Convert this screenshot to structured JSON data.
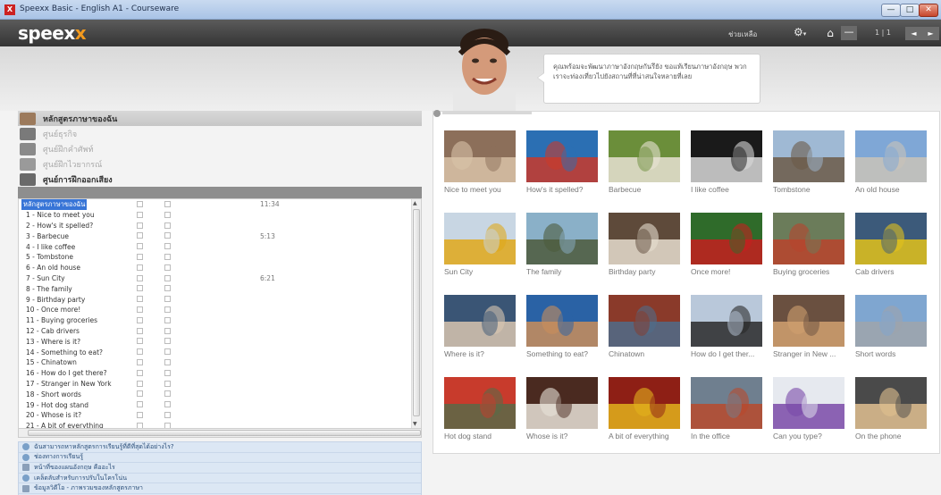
{
  "window": {
    "title": "Speexx Basic - English A1 - Courseware",
    "app_icon": "X"
  },
  "appbar": {
    "logo_main": "speex",
    "logo_accent": "x",
    "help": "ช่วยเหลือ",
    "home_icon": "⌂",
    "minus_label": "—",
    "counter": "1 | 1",
    "prev": "◄",
    "next": "►"
  },
  "tutor": {
    "message": "คุณพร้อมจะพัฒนาภาษาอังกฤษกันรึยัง ขอแท้เรียนภาษาอังกฤษ พวกเราจะท่องเที่ยวไปยังสถานที่ที่น่าสนใจหลายที่เลย"
  },
  "sections": [
    {
      "label": "หลักสูตรภาษาของฉัน",
      "state": "active"
    },
    {
      "label": "ศูนย์ธุรกิจ",
      "state": "disabled"
    },
    {
      "label": "ศูนย์ฝึกคำศัพท์",
      "state": "disabled"
    },
    {
      "label": "ศูนย์ฝึกไวยากรณ์",
      "state": "disabled"
    },
    {
      "label": "ศูนย์การฝึกออกเสียง",
      "state": "bold"
    }
  ],
  "tree": {
    "root": "หลักสูตรภาษาของฉัน",
    "root_time": "11:34",
    "items": [
      {
        "label": "1 - Nice to meet you",
        "time": ""
      },
      {
        "label": "2 - How's it spelled?",
        "time": ""
      },
      {
        "label": "3 - Barbecue",
        "time": "5:13"
      },
      {
        "label": "4 - I like coffee",
        "time": ""
      },
      {
        "label": "5 - Tombstone",
        "time": ""
      },
      {
        "label": "6 - An old house",
        "time": ""
      },
      {
        "label": "7 - Sun City",
        "time": "6:21"
      },
      {
        "label": "8 - The family",
        "time": ""
      },
      {
        "label": "9 - Birthday party",
        "time": ""
      },
      {
        "label": "10 - Once more!",
        "time": ""
      },
      {
        "label": "11 - Buying groceries",
        "time": ""
      },
      {
        "label": "12 - Cab drivers",
        "time": ""
      },
      {
        "label": "13 - Where is it?",
        "time": ""
      },
      {
        "label": "14 - Something to eat?",
        "time": ""
      },
      {
        "label": "15 - Chinatown",
        "time": ""
      },
      {
        "label": "16 - How do I get there?",
        "time": ""
      },
      {
        "label": "17 - Stranger in New York",
        "time": ""
      },
      {
        "label": "18 - Short words",
        "time": ""
      },
      {
        "label": "19 - Hot dog stand",
        "time": ""
      },
      {
        "label": "20 - Whose is it?",
        "time": ""
      },
      {
        "label": "21 - A bit of everything",
        "time": ""
      }
    ],
    "hscroll_mark": "III"
  },
  "help_items": [
    {
      "label": "ฉันสามารถหาหลักสูตรการเรียนรู้ที่ดีที่สุดได้อย่างไร?",
      "icon": "help-circle"
    },
    {
      "label": "ช่องทางการเรียนรู้",
      "icon": "help-circle"
    },
    {
      "label": "หน้าที่ของแผนอังกฤษ คืออะไร",
      "icon": "doc"
    },
    {
      "label": "เคล็ดลับสำหรับการปรับในโครโน่น",
      "icon": "help-circle"
    },
    {
      "label": "ข้อมูลวิดีโอ - ภาพรวมของหลักสูตรภาษา",
      "icon": "doc"
    }
  ],
  "units": [
    {
      "caption": "Nice to meet you",
      "c1": "#8c6f5a",
      "c2": "#d9c3a8"
    },
    {
      "caption": "How's it spelled?",
      "c1": "#2b6fb3",
      "c2": "#c93a2a"
    },
    {
      "caption": "Barbecue",
      "c1": "#6b8e3a",
      "c2": "#e8e2d4"
    },
    {
      "caption": "I like coffee",
      "c1": "#1a1a1a",
      "c2": "#d9d9d9"
    },
    {
      "caption": "Tombstone",
      "c1": "#9fb9d4",
      "c2": "#6c5a48"
    },
    {
      "caption": "An old house",
      "c1": "#7fa7d6",
      "c2": "#c9c3b8"
    },
    {
      "caption": "Sun City",
      "c1": "#c8d6e3",
      "c2": "#e0a81a"
    },
    {
      "caption": "The family",
      "c1": "#8ab0c8",
      "c2": "#4c5b3c"
    },
    {
      "caption": "Birthday party",
      "c1": "#5e4a3a",
      "c2": "#e6ddcf"
    },
    {
      "caption": "Once more!",
      "c1": "#2f6b2a",
      "c2": "#c41f1f"
    },
    {
      "caption": "Buying groceries",
      "c1": "#6b7c5a",
      "c2": "#b8442d"
    },
    {
      "caption": "Cab drivers",
      "c1": "#3c5a7a",
      "c2": "#e2c21a"
    },
    {
      "caption": "Where is it?",
      "c1": "#3a5575",
      "c2": "#d8c6b0"
    },
    {
      "caption": "Something to eat?",
      "c1": "#2a62a5",
      "c2": "#c98e5a"
    },
    {
      "caption": "Chinatown",
      "c1": "#8a3a2a",
      "c2": "#4f6c8a"
    },
    {
      "caption": "How do I get ther...",
      "c1": "#b9c8da",
      "c2": "#2a2a2a"
    },
    {
      "caption": "Stranger in New ...",
      "c1": "#6a5040",
      "c2": "#d0a070"
    },
    {
      "caption": "Short words",
      "c1": "#7fa6d0",
      "c2": "#9fa4ab"
    },
    {
      "caption": "Hot dog stand",
      "c1": "#c83b2c",
      "c2": "#5a6a48"
    },
    {
      "caption": "Whose is it?",
      "c1": "#4a2a20",
      "c2": "#e8e2d8"
    },
    {
      "caption": "A bit of everything",
      "c1": "#8e1f15",
      "c2": "#e2b21c"
    },
    {
      "caption": "In the office",
      "c1": "#6f7f8f",
      "c2": "#b94a2d"
    },
    {
      "caption": "Can you type?",
      "c1": "#e6e9ef",
      "c2": "#7a4aa8"
    },
    {
      "caption": "On the phone",
      "c1": "#4a4a4a",
      "c2": "#e0c090"
    }
  ]
}
